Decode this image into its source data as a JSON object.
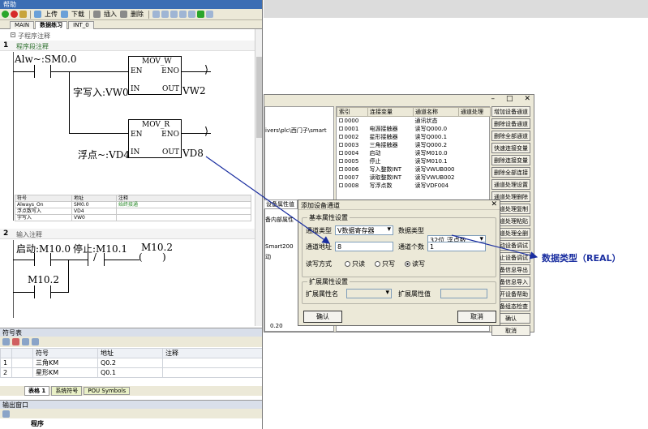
{
  "app": {
    "title": "帮助"
  },
  "toolbar": {
    "upload": "上传",
    "download": "下载",
    "insert": "插入",
    "delete": "删除"
  },
  "tabs": [
    "MAIN",
    "数据练习",
    "INT_0"
  ],
  "editor": {
    "sub_comment": "子程序注释",
    "network1": {
      "num": "1",
      "comment": "程序段注释",
      "contact": "Alw~:SM0.0",
      "box1": {
        "name": "MOV_W",
        "en": "EN",
        "eno": "ENO",
        "in_label": "IN",
        "out_label": "OUT",
        "in_var": "字写入:VW0",
        "out_var": "VW2"
      },
      "box2": {
        "name": "MOV_R",
        "en": "EN",
        "eno": "ENO",
        "in_label": "IN",
        "out_label": "OUT",
        "in_var": "浮点~:VD4",
        "out_var": "VD8"
      },
      "symtable": {
        "headers": [
          "符号",
          "地址",
          "注释"
        ],
        "rows": [
          [
            "Always_On",
            "SM0.0",
            "始终接通"
          ],
          [
            "浮点数写入",
            "VD4",
            ""
          ],
          [
            "字写入",
            "VW0",
            ""
          ]
        ]
      }
    },
    "network2": {
      "num": "2",
      "comment": "输入注释",
      "c1": "启动:M10.0",
      "c2": "停止:M10.1",
      "coil": "M10.2",
      "c3": "M10.2",
      "not": "/"
    }
  },
  "symbol_pane": {
    "title": "符号表",
    "headers": [
      "符号",
      "地址",
      "注释"
    ],
    "rows": [
      [
        "1",
        "三角KM",
        "Q0.2",
        ""
      ],
      [
        "2",
        "星形KM",
        "Q0.1",
        ""
      ]
    ],
    "tabs": [
      "表格 1",
      "系统符号",
      "POU Symbols"
    ]
  },
  "output_pane": {
    "title": "输出窗口",
    "item": "程序"
  },
  "channel_window": {
    "path": "ivers\\plc\\西门子\\smart",
    "headers": [
      "索引",
      "连接变量",
      "通道名称",
      "通道处理"
    ],
    "rows": [
      [
        "0000",
        "",
        "通讯状态",
        ""
      ],
      [
        "0001",
        "电源接触器",
        "读写Q000.0",
        ""
      ],
      [
        "0002",
        "星形接触器",
        "读写Q000.1",
        ""
      ],
      [
        "0003",
        "三角接触器",
        "读写Q000.2",
        ""
      ],
      [
        "0004",
        "启动",
        "读写M010.0",
        ""
      ],
      [
        "0005",
        "停止",
        "读写M010.1",
        ""
      ],
      [
        "0006",
        "写入整数INT",
        "读写VWUB000",
        ""
      ],
      [
        "0007",
        "读取整数INT",
        "读写VWUB002",
        ""
      ],
      [
        "0008",
        "写浮点数",
        "读写VDF004",
        ""
      ]
    ],
    "buttons": [
      "增加设备通道",
      "删除设备通道",
      "删除全部通道",
      "快速连接变量",
      "删除连接变量",
      "删除全部连接",
      "通道处理设置",
      "通道处理删除",
      "通道处理复制",
      "通道处理粘贴",
      "通道处理全删",
      "启动设备调试",
      "停止设备调试",
      "设备信息导出",
      "设备信息导入",
      "打开设备帮助",
      "设备组态检查",
      "确认",
      "取消"
    ],
    "left_labels": [
      "设备属性值",
      "备内部属性",
      "Smart200",
      "动",
      "",
      "0.20"
    ]
  },
  "dialog": {
    "title": "添加设备通道",
    "basic_group": "基本属性设置",
    "channel_type_label": "通道类型",
    "channel_type_value": "V数据寄存器",
    "data_type_label": "数据类型",
    "data_type_value": "32位 浮点数",
    "address_label": "通道地址",
    "address_value": "8",
    "count_label": "通道个数",
    "count_value": "1",
    "rw_label": "读写方式",
    "rw_options": [
      "只读",
      "只写",
      "读写"
    ],
    "ext_group": "扩展属性设置",
    "ext_name_label": "扩展属性名",
    "ext_value_label": "扩展属性值",
    "ok": "确认",
    "cancel": "取消"
  },
  "annotation": {
    "text": "数据类型（REAL）",
    "color": "#1a2ea0"
  }
}
